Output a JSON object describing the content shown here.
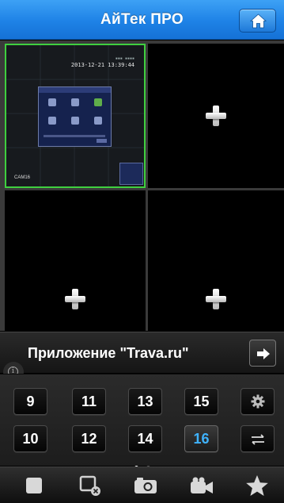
{
  "header": {
    "title": "АйТек ПРО",
    "home_icon": "home-icon"
  },
  "grid": {
    "cells": [
      {
        "state": "live",
        "timestamp": "2013-12-21 13:39:44",
        "camera_label": "CAM16"
      },
      {
        "state": "empty",
        "action_icon": "plus-icon"
      },
      {
        "state": "empty",
        "action_icon": "plus-icon"
      },
      {
        "state": "empty",
        "action_icon": "plus-icon"
      }
    ],
    "selected_cell": 1,
    "selected_color": "#3fcf3f"
  },
  "ad": {
    "text": "Приложение \"Trava.ru\"",
    "arrow_icon": "arrow-right-icon",
    "info_icon": "info-icon"
  },
  "channels": {
    "row1": [
      "9",
      "11",
      "13",
      "15"
    ],
    "row2": [
      "10",
      "12",
      "14",
      "16"
    ],
    "active": "16",
    "active_color": "#3fb3ff",
    "settings_icon": "gear-icon",
    "swap_icon": "swap-icon",
    "page_count": 2,
    "current_page": 1
  },
  "toolbar": {
    "items": [
      "stop-icon",
      "close-all-icon",
      "snapshot-icon",
      "record-icon",
      "favorites-icon"
    ]
  },
  "colors": {
    "header_blue": "#1e82e6",
    "background": "#000000"
  }
}
